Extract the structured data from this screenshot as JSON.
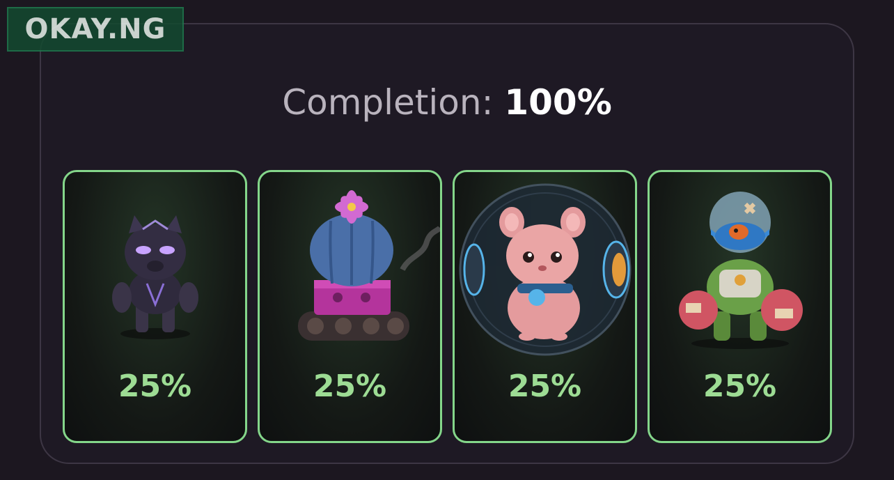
{
  "watermark": "OKAY.NG",
  "completion": {
    "label": "Completion:",
    "value": "100%"
  },
  "cards": [
    {
      "name": "panther",
      "percent": "25%"
    },
    {
      "name": "cactus-tank",
      "percent": "25%"
    },
    {
      "name": "hamster-ball",
      "percent": "25%"
    },
    {
      "name": "fishbowl-robot",
      "percent": "25%"
    }
  ],
  "colors": {
    "accent": "#84d68a",
    "percent_text": "#9ddc94",
    "background": "#1c1720"
  }
}
